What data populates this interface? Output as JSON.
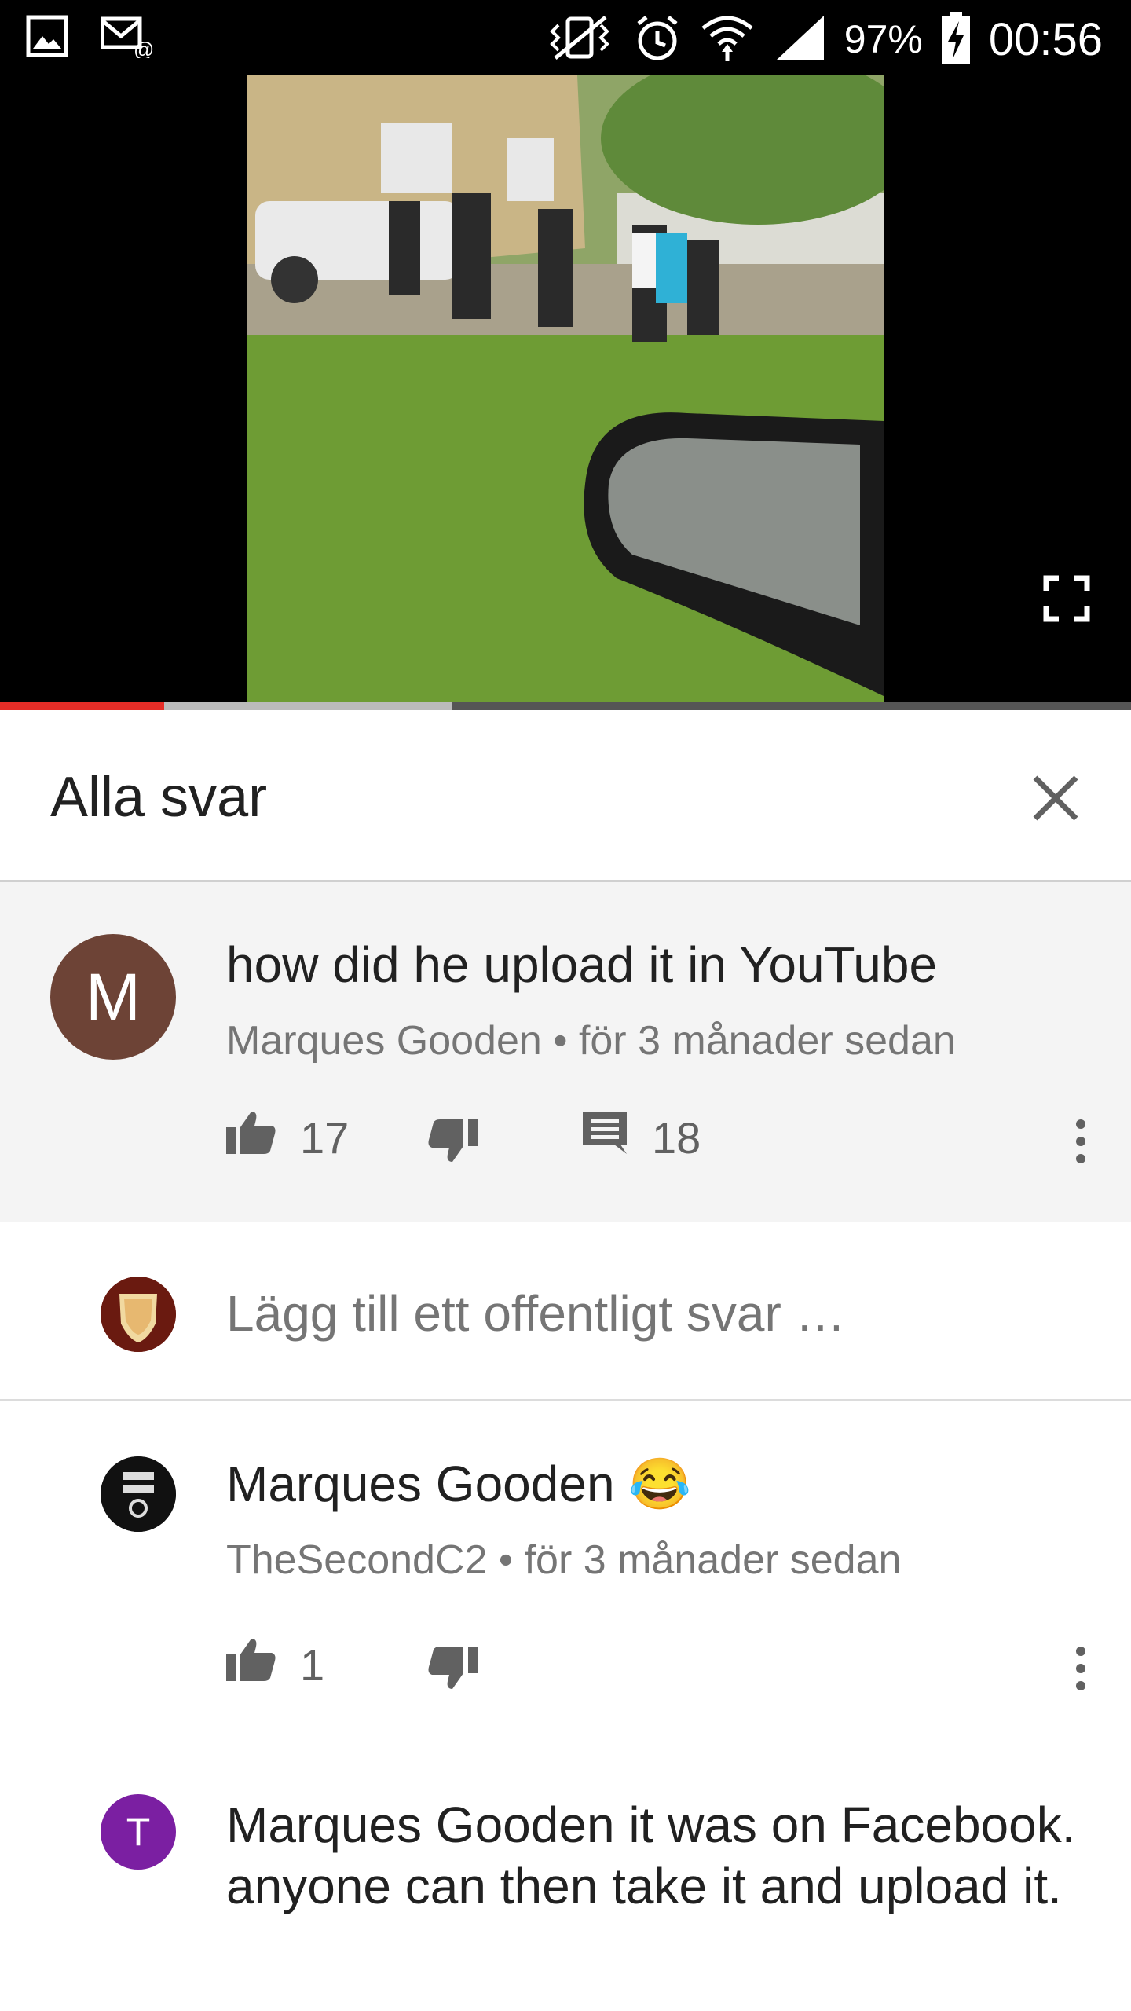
{
  "status_bar": {
    "battery_percent": "97%",
    "time": "00:56",
    "icons": [
      "gallery-icon",
      "email-notification-icon",
      "vibrate-icon",
      "alarm-icon",
      "wifi-icon",
      "signal-icon",
      "battery-charging-icon"
    ]
  },
  "video": {
    "progress_played": 0.145,
    "progress_buffered": 0.4
  },
  "header": {
    "title": "Alla svar"
  },
  "main_comment": {
    "avatar_letter": "M",
    "avatar_color": "#6d4336",
    "text": "how did he upload it in YouTube",
    "author": "Marques Gooden",
    "separator": "•",
    "age": "för 3 månader sedan",
    "likes": "17",
    "replies": "18"
  },
  "reply_input": {
    "placeholder": "Lägg till ett offentligt svar …"
  },
  "replies": [
    {
      "text": "Marques Gooden 😂",
      "author": "TheSecondC2",
      "separator": "•",
      "age": "för 3 månader sedan",
      "likes": "1"
    },
    {
      "avatar_letter": "T",
      "avatar_color": "#7b1fa2",
      "text": "Marques Gooden it was on Facebook.   anyone can then take it and upload it."
    }
  ]
}
